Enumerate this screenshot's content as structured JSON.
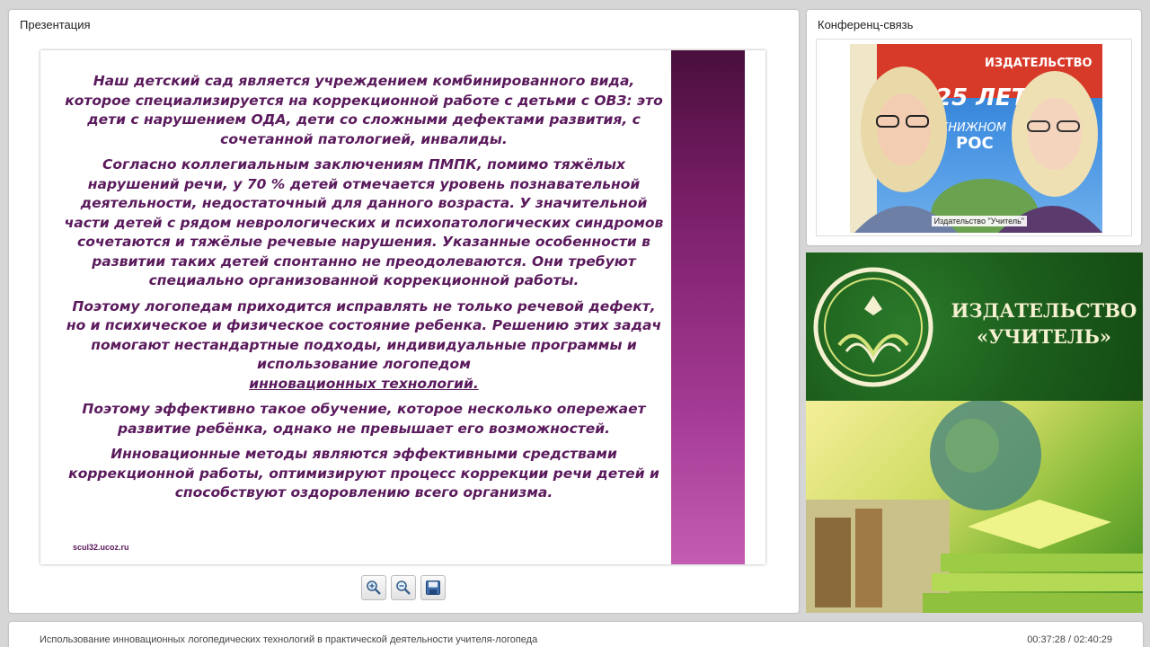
{
  "presentation": {
    "title": "Презентация",
    "slide": {
      "paragraphs": [
        "Наш детский сад является учреждением комбинированного вида, которое специализируется на коррекционной работе с детьми с ОВЗ: это дети с нарушением ОДА, дети со сложными дефектами развития, с сочетанной патологией, инвалиды.",
        "Согласно коллегиальным заключениям ПМПК, помимо тяжёлых нарушений речи, у 70 % детей отмечается уровень познавательной деятельности, недостаточный для данного возраста. У значительной части детей с рядом неврологических и психопатологических синдромов сочетаются и тяжёлые речевые нарушения. Указанные особенности в развитии таких детей спонтанно не преодолеваются. Они требуют специально организованной коррекционной работы.",
        "Поэтому логопедам приходится исправлять не только речевой дефект, но и психическое и физическое состояние ребенка. Решению этих задач помогают нестандартные подходы, индивидуальные программы и использование логопедом",
        "инновационных технологий.",
        "Поэтому эффективно такое обучение, которое несколько опережает развитие ребёнка, однако не превышает его возможностей.",
        "Инновационные методы являются эффективными средствами коррекционной работы, оптимизируют процесс коррекции речи детей и способствуют оздоровлению всего организма."
      ],
      "footer": "scul32.ucoz.ru"
    },
    "toolbar": {
      "zoom_in_icon": "zoom-in-icon",
      "zoom_out_icon": "zoom-out-icon",
      "save_icon": "save-icon"
    }
  },
  "conference": {
    "title": "Конференц-связь",
    "caption": "Издательство \"Учитель\"",
    "banner": {
      "line1": "ИЗДАТЕЛЬСТВО",
      "line2": "25 ЛЕТ",
      "line3": "КНИЖНОМ",
      "line4": "РОС"
    }
  },
  "publisher": {
    "line1": "ИЗДАТЕЛЬСТВО",
    "line2": "«УЧИТЕЛЬ»"
  },
  "bottom": {
    "lecture_title": "Использование инновационных логопедических технологий в практической деятельности учителя-логопеда",
    "time": "00:37:28 / 02:40:29"
  },
  "colors": {
    "slide_text": "#5a1a5c",
    "publisher_green": "#1c5e1c"
  }
}
